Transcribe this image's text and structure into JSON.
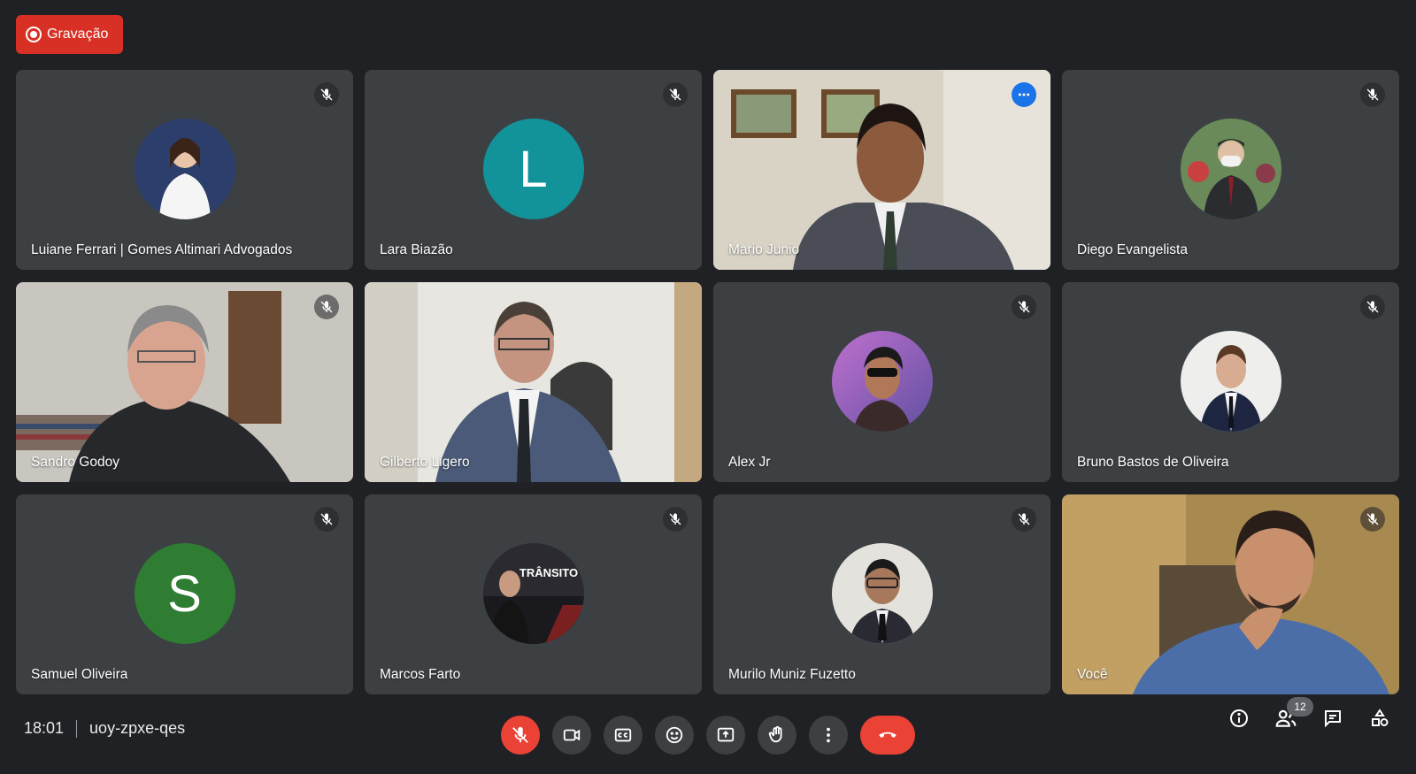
{
  "recording": {
    "label": "Gravação"
  },
  "participants": [
    {
      "name": "Luiane Ferrari | Gomes Altimari Advogados"
    },
    {
      "name": "Lara Biazão",
      "initial": "L"
    },
    {
      "name": "Mario Junio"
    },
    {
      "name": "Diego Evangelista"
    },
    {
      "name": "Sandro Godoy"
    },
    {
      "name": "Gilberto Ligero"
    },
    {
      "name": "Alex Jr"
    },
    {
      "name": "Bruno Bastos de Oliveira"
    },
    {
      "name": "Samuel Oliveira",
      "initial": "S"
    },
    {
      "name": "Marcos Farto",
      "avatar_text": "TRÂNSITO"
    },
    {
      "name": "Murilo Muniz Fuzetto"
    },
    {
      "name": "Você"
    }
  ],
  "meeting": {
    "time": "18:01",
    "code": "uoy-zpxe-qes"
  },
  "controls": [
    "mic-off-icon",
    "camera-icon",
    "captions-icon",
    "emoji-icon",
    "present-icon",
    "raise-hand-icon",
    "more-options-icon",
    "hang-up-icon"
  ],
  "side_panel": {
    "participant_count": "12"
  },
  "colors": {
    "background": "#202124",
    "tile": "#3c4043",
    "recording": "#d93025",
    "hangup": "#ea4335",
    "active_border": "#8ab4f8",
    "lara_avatar": "#12939a",
    "samuel_avatar": "#2e7d32"
  }
}
